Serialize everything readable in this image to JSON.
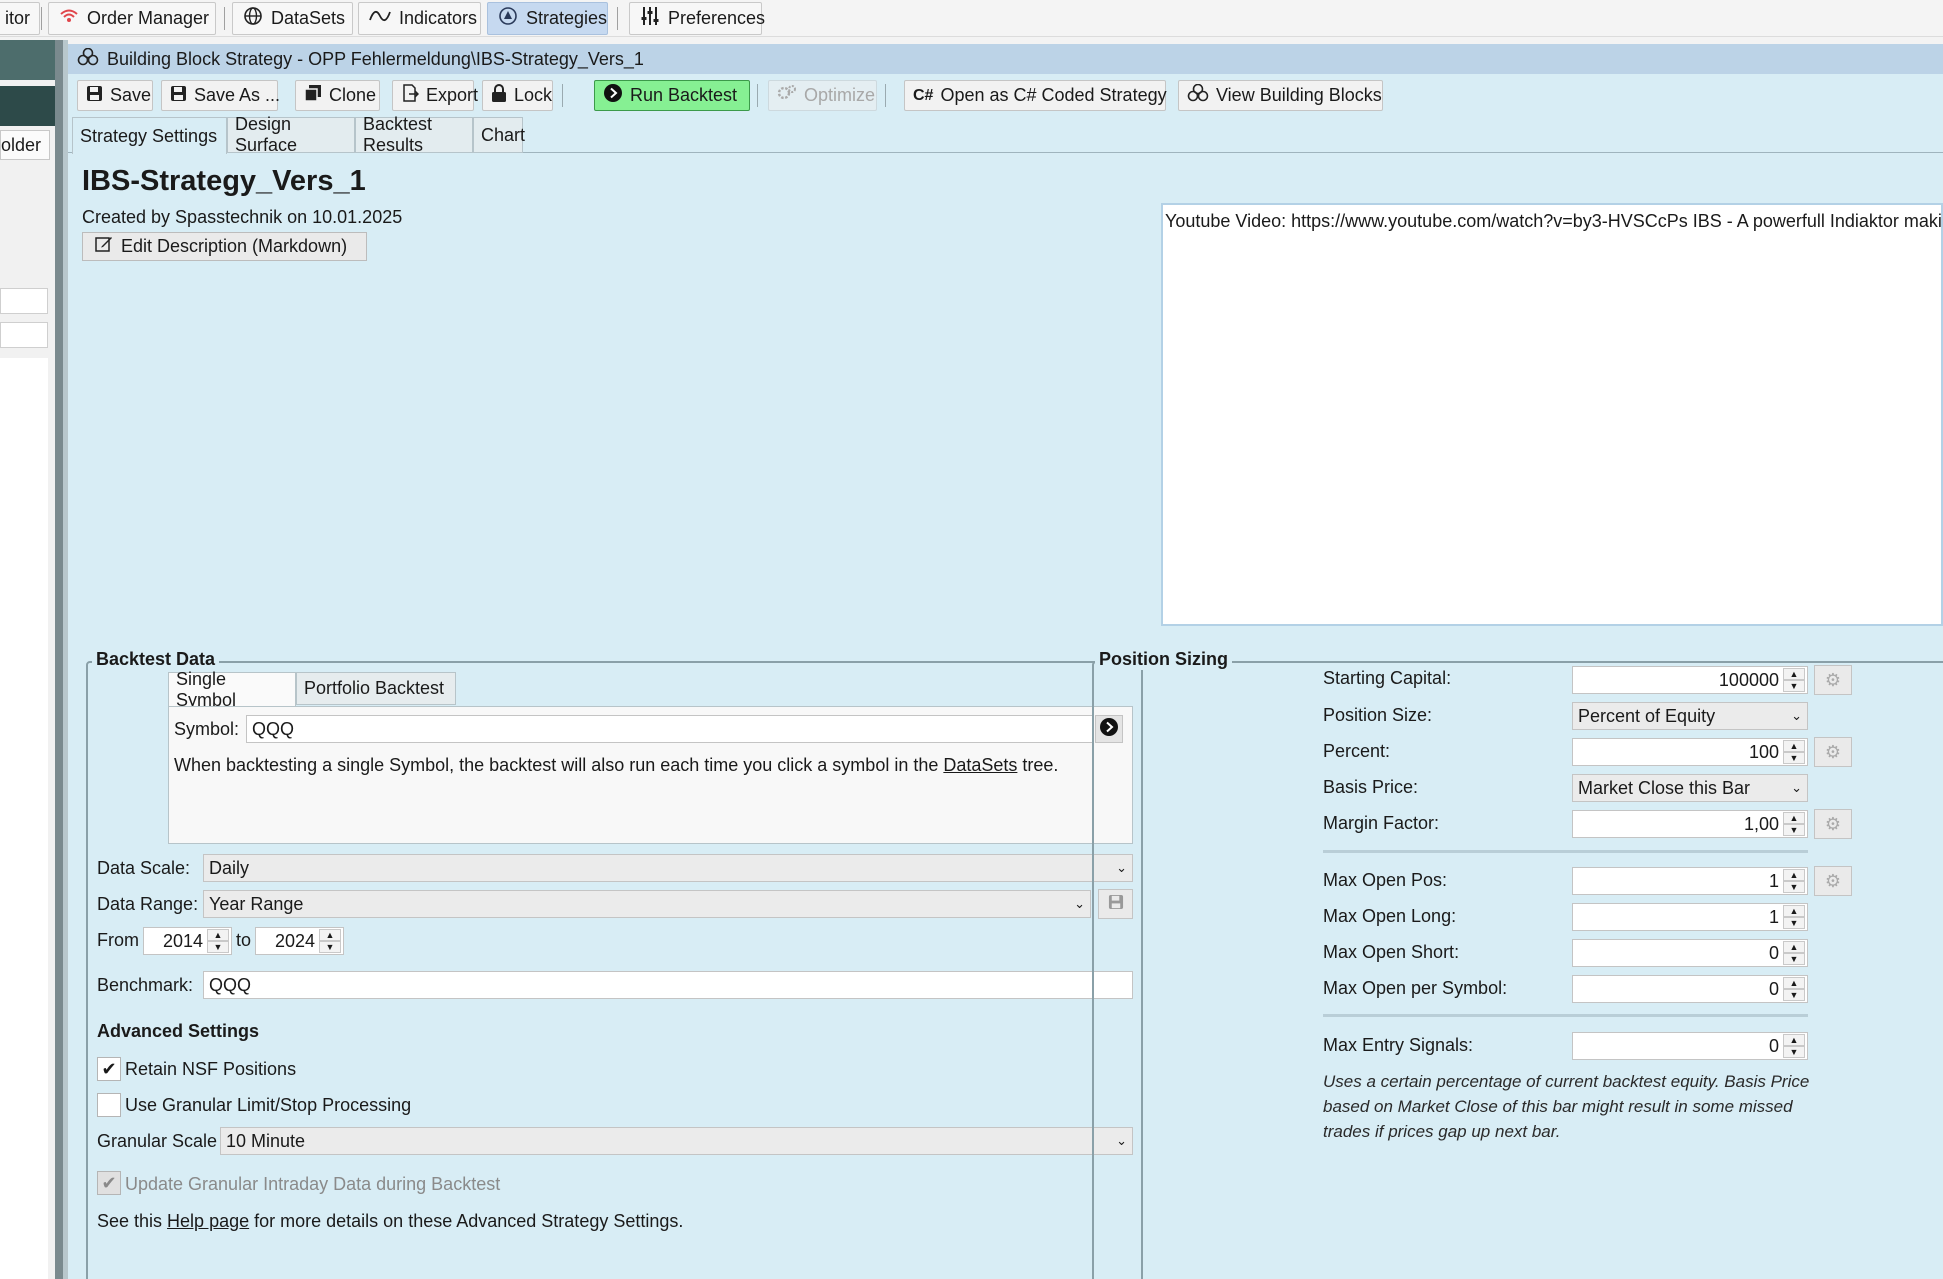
{
  "topbar": {
    "items": [
      {
        "label": "itor",
        "icon": "monitor-icon"
      },
      {
        "label": "Order Manager",
        "icon": "wifi-icon"
      },
      {
        "label": "DataSets",
        "icon": "globe-icon"
      },
      {
        "label": "Indicators",
        "icon": "wave-icon"
      },
      {
        "label": "Strategies",
        "icon": "strategy-icon"
      },
      {
        "label": "Preferences",
        "icon": "sliders-icon"
      }
    ]
  },
  "left": {
    "folder_label": "older"
  },
  "window": {
    "title": "Building Block Strategy - OPP Fehlermeldung\\IBS-Strategy_Vers_1"
  },
  "toolbar": {
    "save": "Save",
    "save_as": "Save As ...",
    "clone": "Clone",
    "export": "Export",
    "lock": "Lock",
    "run_backtest": "Run Backtest",
    "optimize": "Optimize",
    "open_csharp": "Open as C# Coded Strategy",
    "view_blocks": "View Building Blocks",
    "csharp_glyph": "C#"
  },
  "tabs": [
    "Strategy Settings",
    "Design Surface",
    "Backtest Results",
    "Chart"
  ],
  "strategy": {
    "name": "IBS-Strategy_Vers_1",
    "created": "Created by Spasstechnik on 10.01.2025",
    "edit_description": "Edit Description (Markdown)",
    "description": "Youtube Video: https://www.youtube.com/watch?v=by3-HVSCcPs IBS - A powerfull Indiaktor making"
  },
  "backtest_data": {
    "legend": "Backtest Data",
    "tabs": [
      "Single Symbol",
      "Portfolio Backtest"
    ],
    "symbol_label": "Symbol:",
    "symbol_value": "QQQ",
    "info_pre": "When backtesting a single Symbol, the backtest will also run each time you click a symbol in the ",
    "info_link": "DataSets",
    "info_post": " tree.",
    "data_scale_label": "Data Scale:",
    "data_scale_value": "Daily",
    "data_range_label": "Data Range:",
    "data_range_value": "Year Range",
    "from_label": "From",
    "from_value": "2014",
    "to_label": "to",
    "to_value": "2024",
    "benchmark_label": "Benchmark:",
    "benchmark_value": "QQQ",
    "advanced_title": "Advanced Settings",
    "retain_nsf": "Retain NSF Positions",
    "granular_processing": "Use Granular Limit/Stop Processing",
    "granular_scale_label": "Granular Scale",
    "granular_scale_value": "10 Minute",
    "update_granular": "Update Granular Intraday Data during Backtest",
    "help_pre": "See this ",
    "help_link": "Help page",
    "help_post": " for more details on these Advanced Strategy Settings."
  },
  "position_sizing": {
    "legend": "Position Sizing",
    "starting_capital_label": "Starting Capital:",
    "starting_capital_value": "100000",
    "position_size_label": "Position Size:",
    "position_size_value": "Percent of Equity",
    "percent_label": "Percent:",
    "percent_value": "100",
    "basis_price_label": "Basis Price:",
    "basis_price_value": "Market Close this Bar",
    "margin_factor_label": "Margin Factor:",
    "margin_factor_value": "1,00",
    "max_open_pos_label": "Max Open Pos:",
    "max_open_pos_value": "1",
    "max_open_long_label": "Max Open Long:",
    "max_open_long_value": "1",
    "max_open_short_label": "Max Open Short:",
    "max_open_short_value": "0",
    "max_open_symbol_label": "Max Open per Symbol:",
    "max_open_symbol_value": "0",
    "max_entry_label": "Max Entry Signals:",
    "max_entry_value": "0",
    "hint": "Uses a certain percentage of current backtest equity. Basis Price based on Market Close of this bar might result in some missed trades if prices gap up next bar."
  },
  "colors": {
    "run_green": "#86f093",
    "panel_blue": "#d8edf5",
    "title_blue": "#bcd3e7",
    "active_tab": "#c6d9f0"
  }
}
